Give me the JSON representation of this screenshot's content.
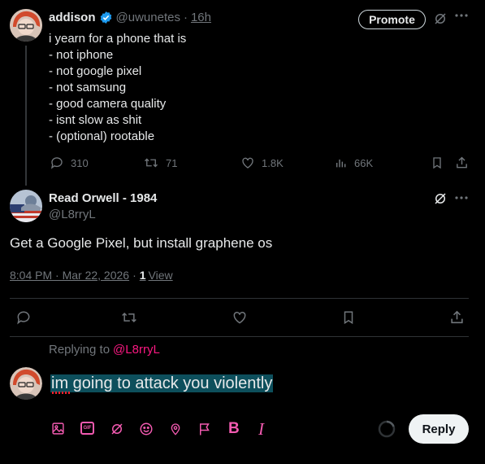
{
  "tweet1": {
    "name": "addison",
    "handle": "@uwunetes",
    "dot": "·",
    "time": "16h",
    "promote": "Promote",
    "lines": [
      "i yearn for a phone that is",
      "- not iphone",
      "- not google pixel",
      "- not samsung",
      "- good camera quality",
      "- isnt slow as shit",
      "- (optional) rootable"
    ],
    "stats": {
      "replies": "310",
      "reposts": "71",
      "likes": "1.8K",
      "views": "66K"
    }
  },
  "tweet2": {
    "name": "Read Orwell - 1984",
    "handle": "@L8rryL",
    "text": "Get a Google Pixel, but install graphene os",
    "timestamp": "8:04 PM · Mar 22, 2026",
    "dot": "·",
    "view_count": "1",
    "view_label": "View"
  },
  "reply": {
    "replying_to_label": "Replying to",
    "replying_to_handle": "@L8rryL",
    "draft_text": "im going to attack you violently",
    "button_label": "Reply"
  },
  "colors": {
    "accent": "#f91880",
    "compose_icons": "#f25ab0",
    "verified": "#1d9bf0",
    "selection": "#0d4f5c"
  },
  "icons": {
    "more": "more-icon",
    "grok": "grok-icon",
    "reply": "reply-icon",
    "repost": "repost-icon",
    "like": "like-icon",
    "views": "views-icon",
    "bookmark": "bookmark-icon",
    "share": "share-icon",
    "image": "image-icon",
    "gif": "gif-icon",
    "emoji": "emoji-icon",
    "location": "location-icon",
    "flag": "flag-icon",
    "bold": "bold-icon",
    "italic": "italic-icon"
  }
}
